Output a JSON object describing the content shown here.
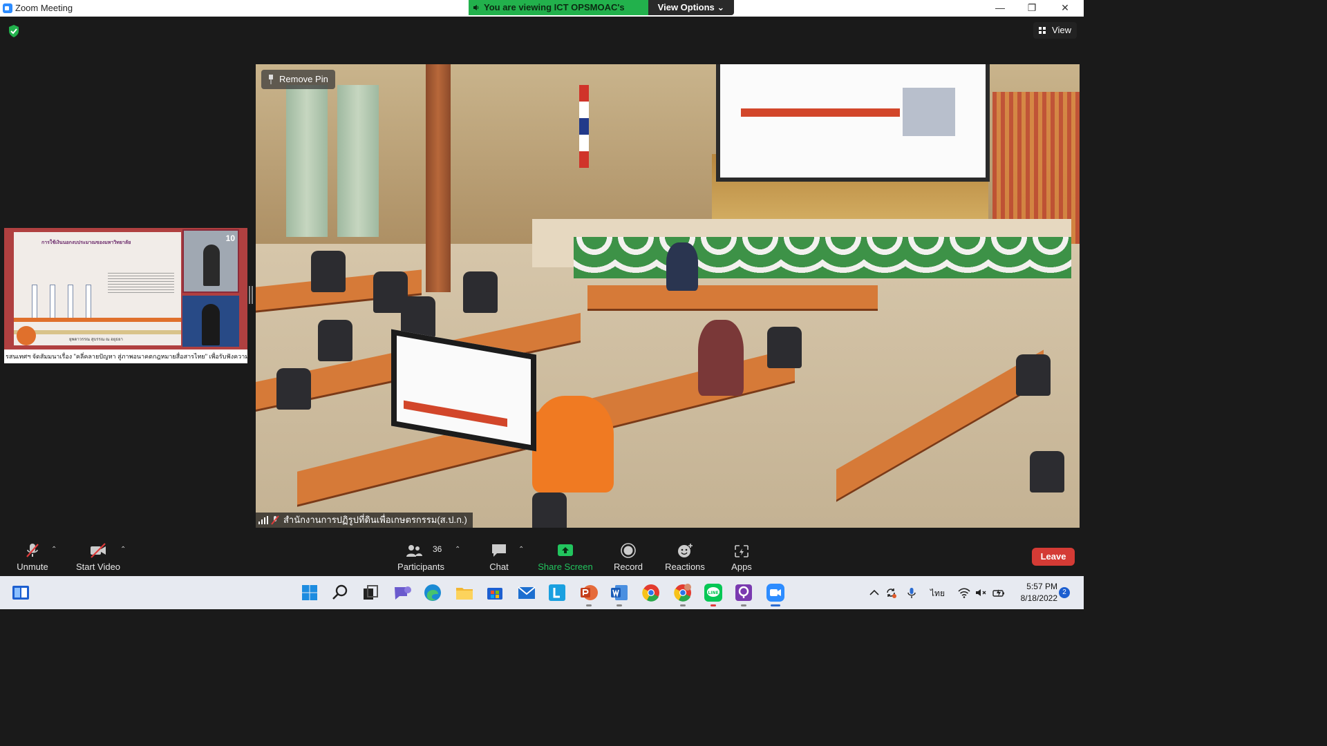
{
  "titlebar": {
    "app_title": "Zoom Meeting",
    "minimize_icon": "minimize-icon",
    "restore_icon": "restore-icon",
    "close_icon": "close-icon"
  },
  "share_banner": {
    "text": "You are viewing ICT OPSMOAC's screen",
    "view_options": "View Options"
  },
  "meeting": {
    "view_label": "View",
    "remove_pin": "Remove Pin",
    "speaker_name": "สำนักงานการปฏิรูปที่ดินเพื่อเกษตรกรรม(ส.ป.ก.)",
    "thumbnail_ticker": "รสนเทศฯ จัดสัมมนาเรื่อง \"คลี่คลายปัญหา สู่ภาพอนาคตกฎหมายสื่อสารไทย\" เพื่อรับฟังความคิดเห็น",
    "thumbnail_slide_title": "การใช้เงินนอกงบประมาณของมหาวิทยาลัย",
    "thumbnail_name": "ยุพดาวรรณ สุบรรณ ณ อยุธยา",
    "thumbnail_live": "10"
  },
  "toolbar": {
    "unmute": "Unmute",
    "start_video": "Start Video",
    "participants": "Participants",
    "participants_count": "36",
    "chat": "Chat",
    "share_screen": "Share Screen",
    "record": "Record",
    "reactions": "Reactions",
    "apps": "Apps",
    "leave": "Leave"
  },
  "taskbar": {
    "time": "5:57 PM",
    "date": "8/18/2022",
    "language": "ไทย",
    "notification_count": "2"
  },
  "colors": {
    "share_banner_green": "#22b14c",
    "share_screen_green": "#22c55e",
    "leave_red": "#d43b35",
    "zoom_blue": "#2d8cff"
  }
}
